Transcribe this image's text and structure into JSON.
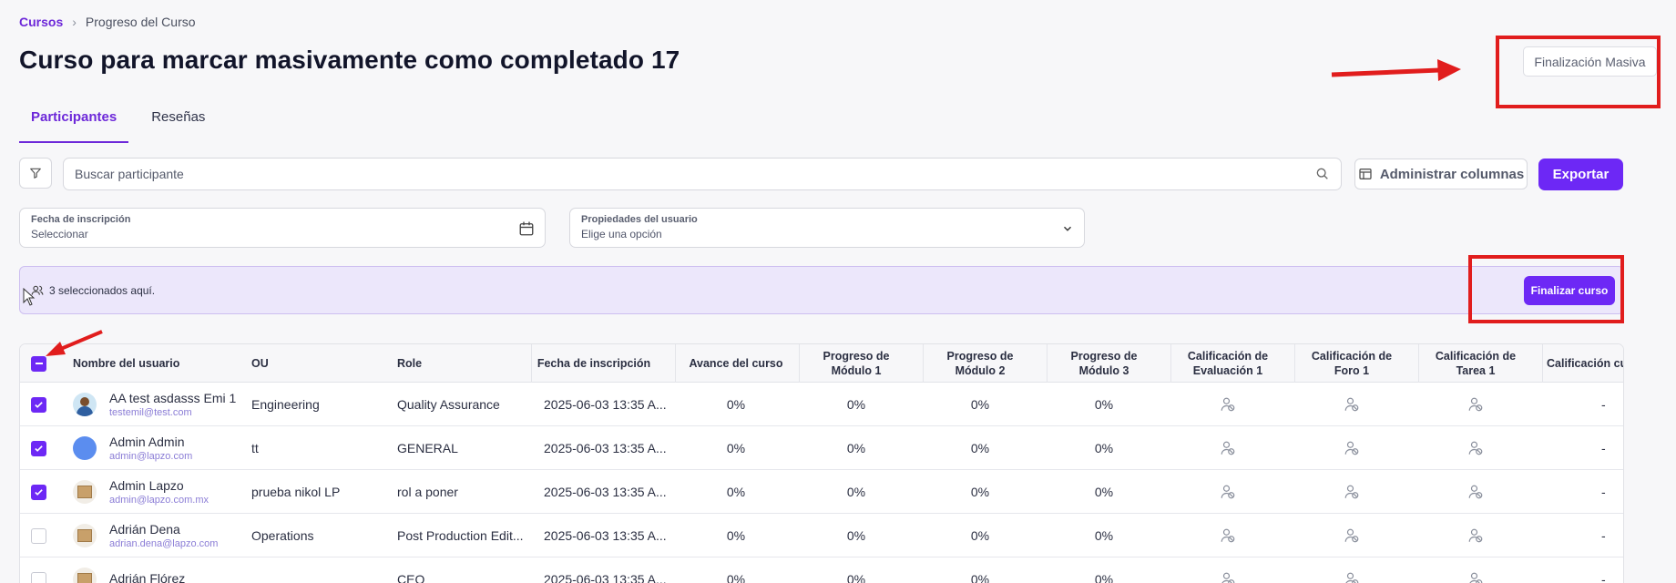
{
  "breadcrumb": {
    "root": "Cursos",
    "current": "Progreso del Curso"
  },
  "page_title": "Curso para marcar masivamente como completado 17",
  "header_actions": {
    "bulk_finish_label": "Finalización Masiva"
  },
  "tabs": [
    {
      "label": "Participantes",
      "active": true
    },
    {
      "label": "Reseñas",
      "active": false
    }
  ],
  "toolbar": {
    "search_placeholder": "Buscar participante",
    "manage_columns_label": "Administrar columnas",
    "export_label": "Exportar"
  },
  "filters": {
    "enrollment_date": {
      "label": "Fecha de inscripción",
      "value": "Seleccionar"
    },
    "user_properties": {
      "label": "Propiedades del usuario",
      "value": "Elige una opción"
    }
  },
  "selection_bar": {
    "text": "3 seleccionados aquí.",
    "finish_label": "Finalizar curso"
  },
  "table": {
    "headers": {
      "name": "Nombre del usuario",
      "ou": "OU",
      "role": "Role",
      "enroll": "Fecha de inscripción",
      "progress": "Avance del curso",
      "m1": "Progreso de Módulo 1",
      "m2": "Progreso de Módulo 2",
      "m3": "Progreso de Módulo 3",
      "eval1": "Calificación de Evaluación 1",
      "forum1": "Calificación de Foro 1",
      "task1": "Calificación de Tarea 1",
      "course": "Calificación curso"
    },
    "rows": [
      {
        "name": "AA test asdasss Emi 1",
        "email": "testemil@test.com",
        "ou": "Engineering",
        "role": "Quality Assurance",
        "enroll": "2025-06-03 13:35 A...",
        "progress": "0%",
        "m1": "0%",
        "m2": "0%",
        "m3": "0%",
        "course": "-",
        "checked": true,
        "avatar": "photo"
      },
      {
        "name": "Admin Admin",
        "email": "admin@lapzo.com",
        "ou": "tt",
        "role": "GENERAL",
        "enroll": "2025-06-03 13:35 A...",
        "progress": "0%",
        "m1": "0%",
        "m2": "0%",
        "m3": "0%",
        "course": "-",
        "checked": true,
        "avatar": "blue"
      },
      {
        "name": "Admin Lapzo",
        "email": "admin@lapzo.com.mx",
        "ou": "prueba nikol LP",
        "role": "rol a poner",
        "enroll": "2025-06-03 13:35 A...",
        "progress": "0%",
        "m1": "0%",
        "m2": "0%",
        "m3": "0%",
        "course": "-",
        "checked": true,
        "avatar": "box"
      },
      {
        "name": "Adrián Dena",
        "email": "adrian.dena@lapzo.com",
        "ou": "Operations",
        "role": "Post Production Edit...",
        "enroll": "2025-06-03 13:35 A...",
        "progress": "0%",
        "m1": "0%",
        "m2": "0%",
        "m3": "0%",
        "course": "-",
        "checked": false,
        "avatar": "box"
      },
      {
        "name": "Adrián Flórez",
        "email": "",
        "ou": "",
        "role": "CEO",
        "enroll": "2025-06-03 13:35 A...",
        "progress": "0%",
        "m1": "0%",
        "m2": "0%",
        "m3": "0%",
        "course": "-",
        "checked": false,
        "avatar": "box"
      }
    ]
  },
  "colors": {
    "accent": "#6d28f5",
    "annotation": "#e11d1d",
    "selection_bg": "#ece7fb"
  }
}
